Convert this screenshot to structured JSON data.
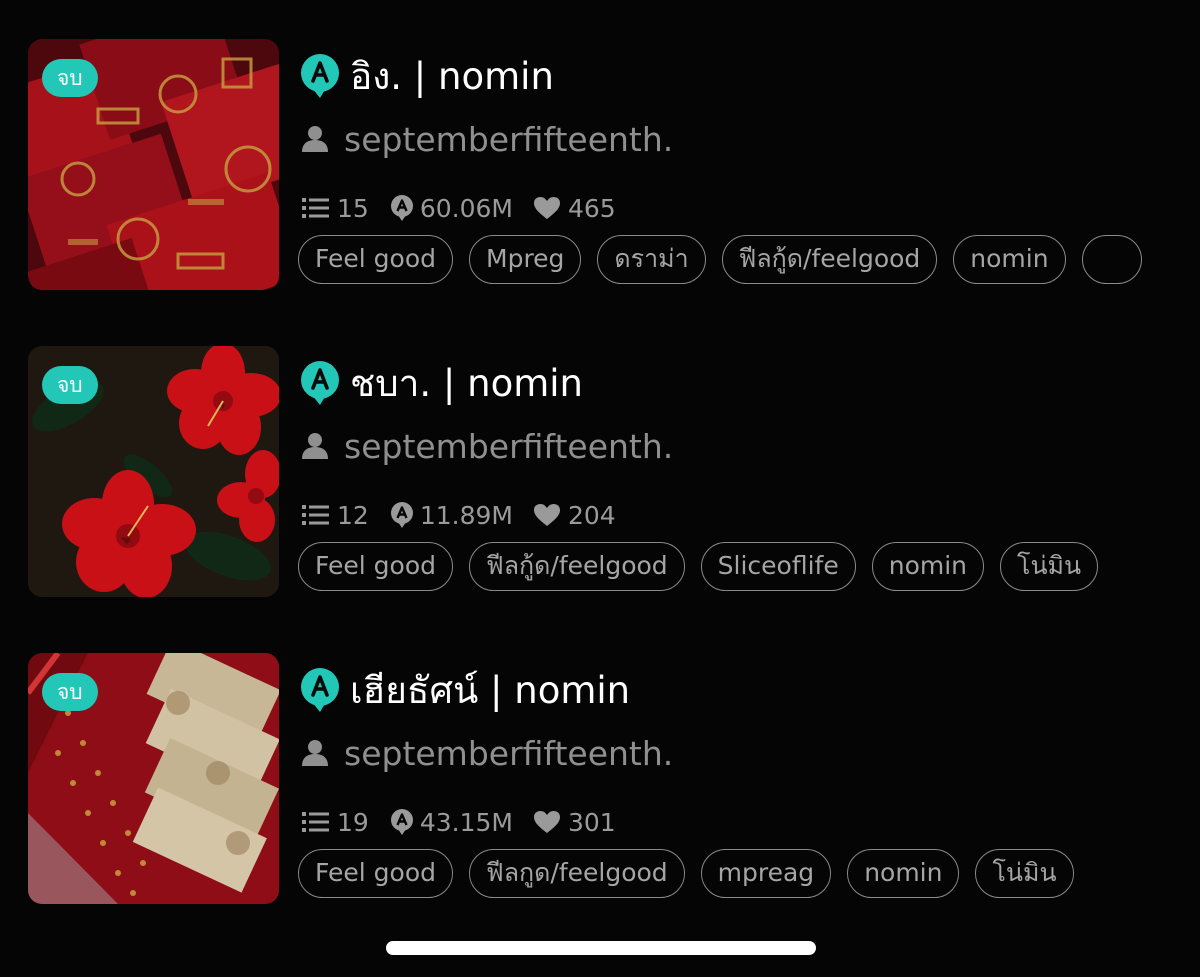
{
  "stories": [
    {
      "status_badge": "จบ",
      "title": "อิง. | nomin",
      "author": "septemberfifteenth.",
      "chapters": "15",
      "views": "60.06M",
      "likes": "465",
      "tags": [
        "Feel good",
        "Mpreg",
        "ดราม่า",
        "ฟีลกู้ด/feelgood",
        "nomin",
        ""
      ],
      "cover_icon": "red-envelopes-image"
    },
    {
      "status_badge": "จบ",
      "title": "ชบา. | nomin",
      "author": "septemberfifteenth.",
      "chapters": "12",
      "views": "11.89M",
      "likes": "204",
      "tags": [
        "Feel good",
        "ฟีลกู้ด/feelgood",
        "Sliceoflife",
        "nomin",
        "โน่มิน"
      ],
      "cover_icon": "red-hibiscus-image"
    },
    {
      "status_badge": "จบ",
      "title": "เฮียธัศน์ | nomin",
      "author": "septemberfifteenth.",
      "chapters": "19",
      "views": "43.15M",
      "likes": "301",
      "tags": [
        "Feel good",
        "ฟีลกูด/feelgood",
        "mpreag",
        "nomin",
        "โน่มิน"
      ],
      "cover_icon": "money-gold-tray-image"
    }
  ],
  "colors": {
    "background": "#050505",
    "badge": "#22c7b8",
    "app_icon": "#22c7b8",
    "meta_text": "#9a9a9a",
    "tag_border": "#8a8a8a"
  },
  "icons": {
    "app": "readawrite-icon",
    "author": "user-icon",
    "chapters": "list-icon",
    "views": "views-bubble-icon",
    "likes": "heart-icon"
  }
}
